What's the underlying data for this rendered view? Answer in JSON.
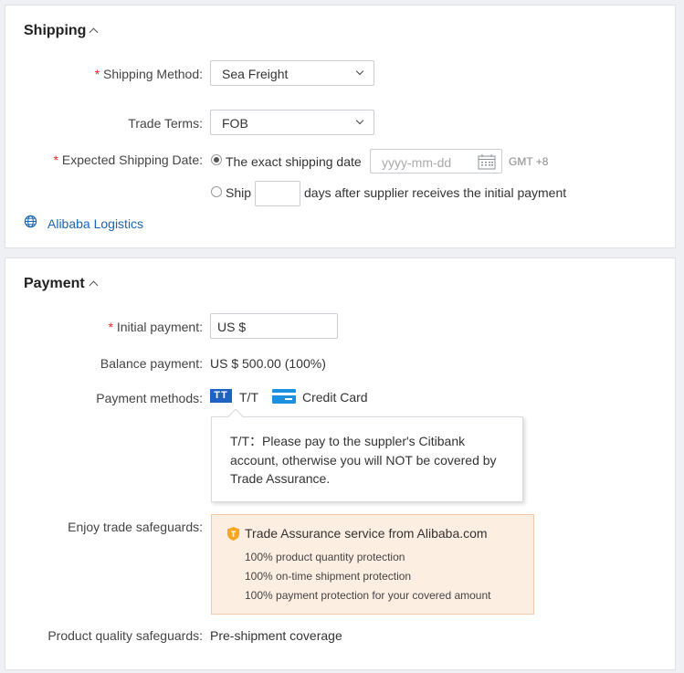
{
  "shipping": {
    "title": "Shipping",
    "method": {
      "label": "Shipping Method:",
      "value": "Sea Freight",
      "required": "*"
    },
    "trade_terms": {
      "label": "Trade Terms:",
      "value": "FOB"
    },
    "date": {
      "label": "Expected Shipping Date:",
      "required": "*",
      "option_exact": "The exact shipping date",
      "date_placeholder": "yyyy-mm-dd",
      "timezone": "GMT +8",
      "option_ship": "Ship",
      "ship_suffix": "days after supplier receives the initial payment"
    },
    "logistics_link": "Alibaba Logistics"
  },
  "payment": {
    "title": "Payment",
    "initial": {
      "label": "Initial payment:",
      "required": "*",
      "value": "US $"
    },
    "balance": {
      "label": "Balance payment:",
      "value": "US $ 500.00 (100%)"
    },
    "methods": {
      "label": "Payment methods:",
      "tt_badge": "TT",
      "tt_label": "T/T",
      "card_label": "Credit Card"
    },
    "tooltip": "T/T：Please pay to the suppler's Citibank account, otherwise you will NOT be covered by Trade Assurance.",
    "safeguards": {
      "label": "Enjoy trade safeguards:",
      "title": "Trade Assurance service from Alibaba.com",
      "items": [
        "100% product quantity protection",
        "100% on-time shipment protection",
        "100% payment protection for your covered amount"
      ]
    },
    "quality": {
      "label": "Product quality safeguards:",
      "value": "Pre-shipment coverage"
    }
  },
  "colors": {
    "accent": "#1a64b3",
    "required": "#ee2222",
    "tt_blue": "#1e63c3",
    "assurance_bg": "#fdeee2",
    "assurance_icon": "#f5a623"
  }
}
